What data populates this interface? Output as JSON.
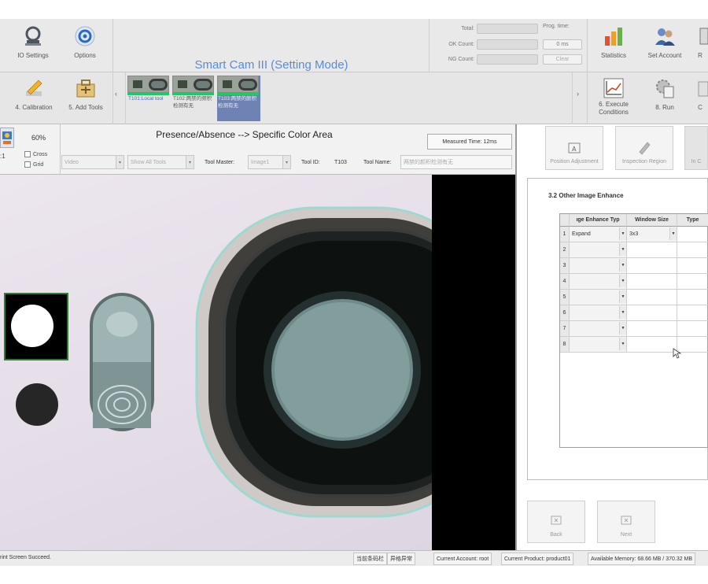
{
  "app": {
    "title": "Smart Cam III   (Setting Mode)"
  },
  "toolbar1": {
    "io_settings": "IO Settings",
    "options": "Options",
    "total_label": "Total:",
    "ok_label": "OK Count:",
    "ng_label": "NG Count:",
    "prog_time_label": "Prog. time:",
    "prog_time_value": "0 ms",
    "clear": "Clear",
    "statistics": "Statistics",
    "set_account": "Set Account",
    "cut_label": "R"
  },
  "toolbar2": {
    "calibration": "4. Calibration",
    "add_tools": "5. Add Tools",
    "left_arrow": "‹",
    "right_arrow": "›",
    "execute_conditions": "6. Execute Conditions",
    "run": "8. Run",
    "cut_label": "C",
    "tools": [
      {
        "label": "T101:Local tool"
      },
      {
        "label": "T102:两禁的频积检测有无"
      },
      {
        "label": "T103:两禁的颜积检测有无"
      }
    ]
  },
  "tool_header": {
    "zoom": "60%",
    "ratio": ":1",
    "cross": "Cross",
    "grid": "Grid",
    "title": "Presence/Absence --> Specific Color Area",
    "measured_time": "Measured Time: 12ms",
    "video": "Video",
    "show_all_tools": "Show All Tools",
    "tool_master_label": "Tool Master:",
    "tool_master_value": "Image1",
    "tool_id_label": "Tool ID:",
    "tool_id_value": "T103",
    "tool_name_label": "Tool Name:",
    "tool_name_value": "两禁的颜积检测有无"
  },
  "right_panel": {
    "position_adjustment": "Position Adjustment",
    "inspection_region": "Inspection Region",
    "cut_button": "In C",
    "section_title": "3.2 Other Image Enhance",
    "columns": [
      "ıge Enhance Typ",
      "Window Size",
      "Type"
    ],
    "rows": [
      {
        "num": "1",
        "type": "Expand",
        "window": "3x3"
      },
      {
        "num": "2",
        "type": "",
        "window": ""
      },
      {
        "num": "3",
        "type": "",
        "window": ""
      },
      {
        "num": "4",
        "type": "",
        "window": ""
      },
      {
        "num": "5",
        "type": "",
        "window": ""
      },
      {
        "num": "6",
        "type": "",
        "window": ""
      },
      {
        "num": "7",
        "type": "",
        "window": ""
      },
      {
        "num": "8",
        "type": "",
        "window": ""
      }
    ],
    "back": "Back",
    "next": "Next"
  },
  "status": {
    "message": "rint Screen Succeed.",
    "btn1": "当前条码栏",
    "btn2": "异格异常",
    "account": "Current Account: root",
    "product": "Current Product: product01",
    "memory": "Available Memory: 68.66 MB / 370.32 MB"
  },
  "colors": {
    "title_blue": "#5b8bd4",
    "tool_selected": "#6f82b4",
    "ok_green": "#27c46a",
    "roi_border": "#2e7d32"
  }
}
